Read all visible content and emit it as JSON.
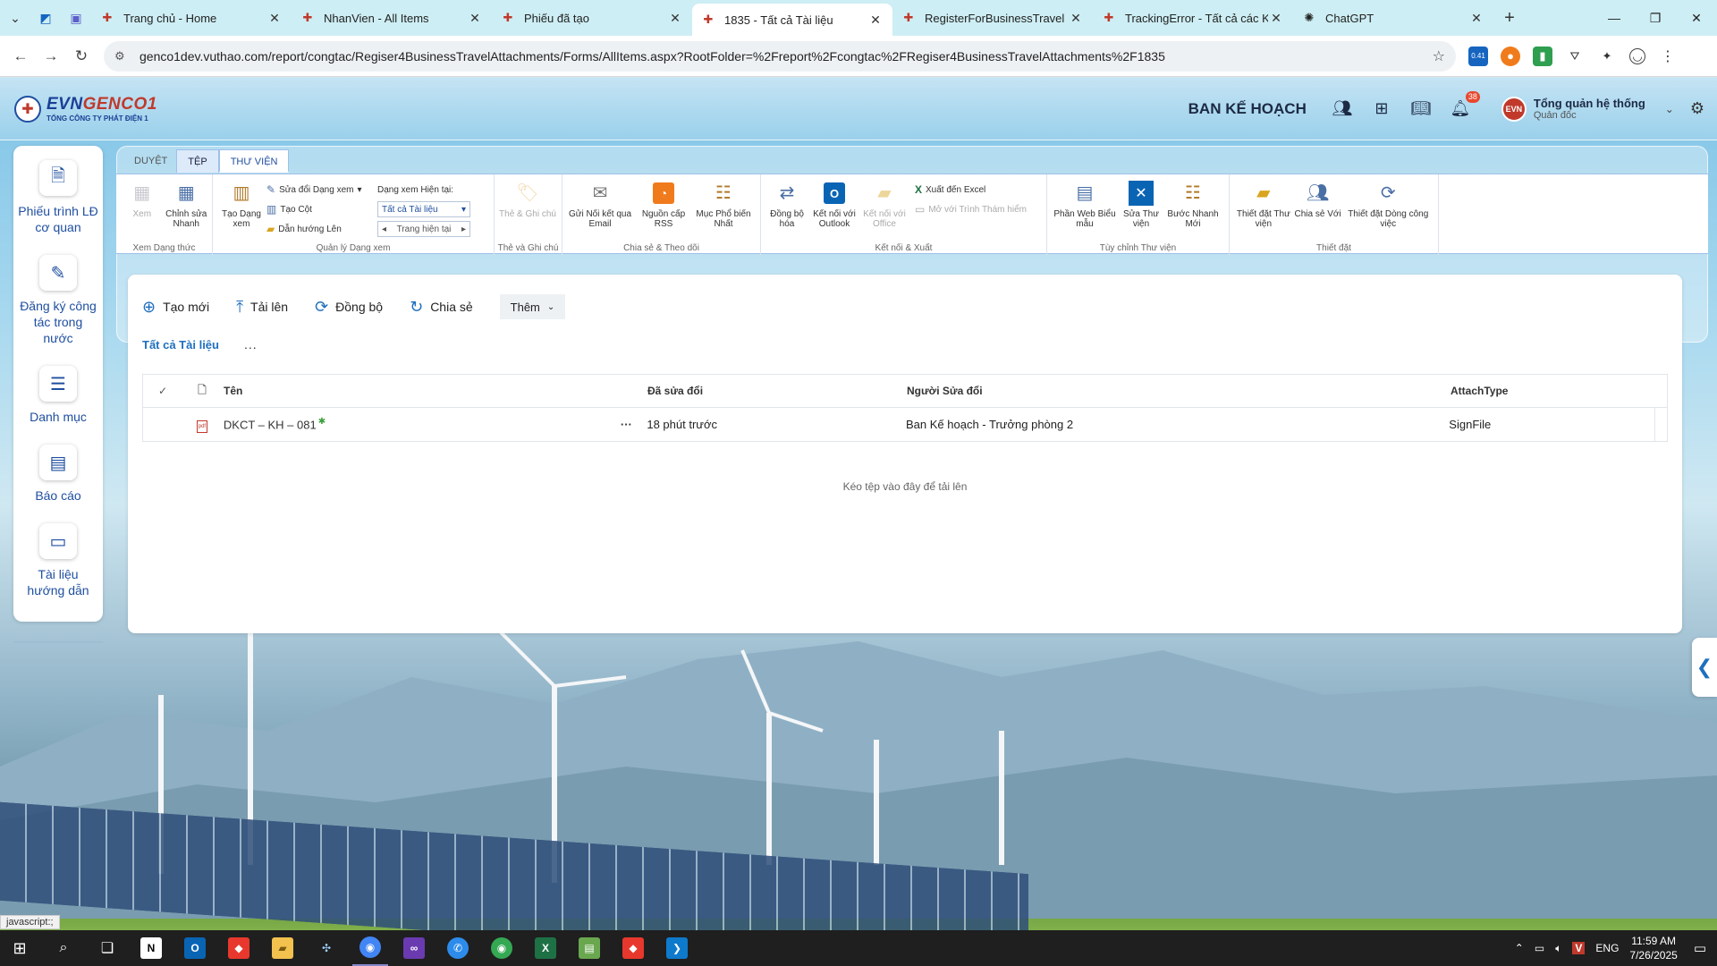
{
  "browser": {
    "tabs": [
      {
        "title": "Trang chủ - Home",
        "active": false
      },
      {
        "title": "NhanVien - All Items",
        "active": false
      },
      {
        "title": "Phiếu đã tạo",
        "active": false
      },
      {
        "title": "1835 - Tất cả Tài liệu",
        "active": true
      },
      {
        "title": "RegisterForBusinessTravel",
        "active": false
      },
      {
        "title": "TrackingError - Tất cả các Khoản",
        "active": false
      },
      {
        "title": "ChatGPT",
        "active": false
      }
    ],
    "url": "genco1dev.vuthao.com/report/congtac/Regiser4BusinessTravelAttachments/Forms/AllItems.aspx?RootFolder=%2Freport%2Fcongtac%2FRegiser4BusinessTravelAttachments%2F1835",
    "extension_badge": "0.41"
  },
  "header": {
    "logo_name_a": "EVN",
    "logo_name_b": "GENCO1",
    "logo_sub": "TỔNG CÔNG TY PHÁT ĐIỆN 1",
    "department": "BAN KẾ HOẠCH",
    "notification_count": "38",
    "user_name": "Tổng quản hệ thống",
    "user_role": "Quản đốc",
    "avatar_text": "EVN"
  },
  "sidebar": {
    "items": [
      {
        "label": "Phiếu trình LĐ cơ quan",
        "icon": "document-stamp-icon"
      },
      {
        "label": "Đăng ký công tác trong nước",
        "icon": "form-edit-icon"
      },
      {
        "label": "Danh mục",
        "icon": "list-icon"
      },
      {
        "label": "Báo cáo",
        "icon": "report-chart-icon"
      },
      {
        "label": "Tài liệu hướng dẫn",
        "icon": "guide-document-icon"
      }
    ]
  },
  "ribbon": {
    "tabs": [
      "DUYỆT",
      "TỆP",
      "THƯ VIỆN"
    ],
    "active_tab": "THƯ VIỆN",
    "groups": {
      "view_format": {
        "label": "Xem Dạng thức",
        "view": "Xem",
        "quick_edit": "Chỉnh sửa Nhanh"
      },
      "manage_views": {
        "label": "Quản lý Dạng xem",
        "create_view": "Tạo Dạng xem",
        "modify_view": "Sửa đổi Dạng xem",
        "create_column": "Tạo Cột",
        "navigate_up": "Dẫn hướng Lên",
        "current_view_label": "Dạng xem Hiện tại:",
        "current_view_value": "Tất cả Tài liệu",
        "current_page": "Trang hiện tại"
      },
      "tags_notes": {
        "label": "Thẻ và Ghi chú",
        "tags_notes_btn": "Thẻ & Ghi chú"
      },
      "share_track": {
        "label": "Chia sẻ & Theo dõi",
        "email_link": "Gửi Nối kết qua Email",
        "rss": "Nguồn cấp RSS",
        "most_popular": "Mục Phổ biến Nhất"
      },
      "connect_export": {
        "label": "Kết nối & Xuất",
        "sync": "Đồng bộ hóa",
        "outlook": "Kết nối với Outlook",
        "office": "Kết nối với Office",
        "export_excel": "Xuất đến Excel",
        "open_explorer": "Mở với Trình Thám hiểm"
      },
      "customize": {
        "label": "Tùy chỉnh Thư viện",
        "web_parts": "Phần Web Biểu mẫu",
        "edit_library": "Sửa Thư viện",
        "new_quick_step": "Bước Nhanh Mới"
      },
      "settings": {
        "label": "Thiết đặt",
        "library_settings": "Thiết đặt Thư viện",
        "share_with": "Chia sẻ Với",
        "workflow_settings": "Thiết đặt Dòng công việc"
      }
    }
  },
  "commands": {
    "new": "Tạo mới",
    "upload": "Tải lên",
    "sync": "Đồng bộ",
    "share": "Chia sẻ",
    "more": "Thêm"
  },
  "view": {
    "name": "Tất cả Tài liệu",
    "dots": "..."
  },
  "table": {
    "headers": {
      "name": "Tên",
      "modified": "Đã sửa đổi",
      "modified_by": "Người Sửa đổi",
      "attach_type": "AttachType"
    },
    "rows": [
      {
        "name": "DKCT – KH – 081",
        "modified": "18 phút trước",
        "modified_by": "Ban Kế hoạch - Trưởng phòng 2",
        "attach_type": "SignFile"
      }
    ],
    "dropzone": "Kéo tệp vào đây để tải lên"
  },
  "status_tip": "javascript:;",
  "taskbar": {
    "language": "ENG",
    "time": "11:59 AM",
    "date": "7/26/2025"
  },
  "colors": {
    "accent": "#1f6fbf",
    "brand_blue": "#1a3f95",
    "brand_red": "#c0392b"
  }
}
